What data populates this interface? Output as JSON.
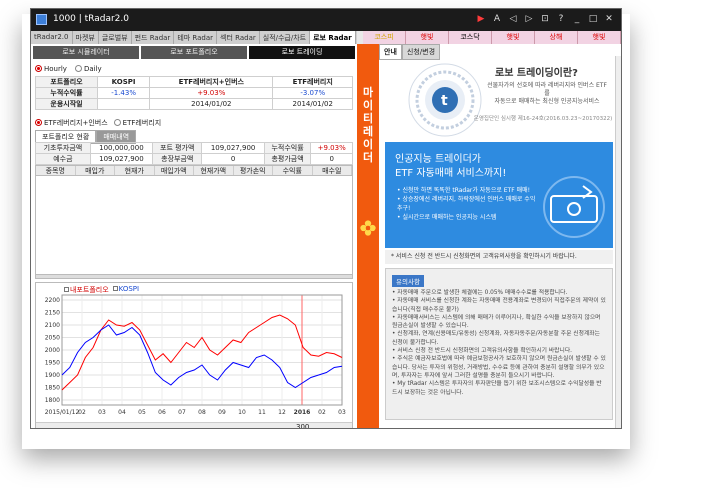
{
  "window": {
    "title": "1000 | tRadar2.0"
  },
  "top_tabs": [
    "tRadar2.0",
    "마켓뷰",
    "글로벌뷰",
    "펀드 Radar",
    "테마 Radar",
    "섹터 Radar",
    "실적/수급/차트",
    "로보 Radar"
  ],
  "index_bar": [
    {
      "label": "코스피",
      "color": "#d1a400"
    },
    {
      "label": "햇빛",
      "color": "#d00000"
    },
    {
      "label": "코스닥",
      "color": "#000000"
    },
    {
      "label": "햇빛",
      "color": "#d00000"
    },
    {
      "label": "상해",
      "color": "#d00000"
    },
    {
      "label": "햇빛",
      "color": "#d00000"
    }
  ],
  "sub_buttons": [
    "로보 시뮬레이터",
    "로보 포트폴리오",
    "로보 트레이딩"
  ],
  "period": {
    "hourly": "Hourly",
    "daily": "Daily",
    "selected": "Hourly"
  },
  "summary_table": {
    "headers": [
      "포트폴리오",
      "KOSPI",
      "ETF레버리지+인버스",
      "ETF레버리지"
    ],
    "rows": [
      {
        "label": "누적수익률",
        "values": [
          "-1.43%",
          "+9.03%",
          "-3.07%"
        ]
      },
      {
        "label": "운용시작일",
        "values": [
          "",
          "2014/01/02",
          "2014/01/02"
        ]
      }
    ]
  },
  "strategy": {
    "opt1": "ETF레버리지+인버스",
    "opt2": "ETF레버리지",
    "selected": "ETF레버리지+인버스"
  },
  "portfolio_tabs": [
    "포트폴리오 현황",
    "매매내역"
  ],
  "portfolio_table": {
    "rows": [
      [
        "기초투자금액",
        "100,000,000",
        "포트 평가액",
        "109,027,900",
        "누적수익률",
        "+9.03%"
      ],
      [
        "예수금",
        "109,027,900",
        "총장부금액",
        "0",
        "총평가금액",
        "0"
      ]
    ]
  },
  "holdings_columns": [
    "종목명",
    "매입가",
    "현재가",
    "매입가액",
    "현재가액",
    "평가손익",
    "수익률",
    "매수일"
  ],
  "chart_data": {
    "type": "line",
    "series": [
      {
        "name": "내포트폴리오",
        "color": "#ff0000",
        "values": [
          1840,
          1870,
          1900,
          1970,
          2010,
          2080,
          2120,
          2100,
          2095,
          2110,
          2080,
          2020,
          1960,
          1985,
          1950,
          1990,
          2030,
          2010,
          2050,
          2000,
          1980,
          2010,
          2040,
          2030,
          2070,
          2090,
          2110,
          2130,
          2140,
          2125,
          2100,
          2010,
          1980,
          1975,
          1990,
          1985,
          1970
        ]
      },
      {
        "name": "KOSPI",
        "color": "#0000ff",
        "values": [
          1900,
          1930,
          1990,
          2030,
          2050,
          2080,
          2100,
          2060,
          2070,
          2090,
          2060,
          1990,
          1910,
          1880,
          1860,
          1890,
          1910,
          1920,
          1940,
          1900,
          1880,
          1920,
          1950,
          1940,
          1930,
          1970,
          1980,
          1960,
          1930,
          1870,
          1850,
          1870,
          1890,
          1900,
          1910,
          1930,
          1935
        ]
      }
    ],
    "x_ticks": [
      "2015/01/12",
      "02",
      "03",
      "04",
      "05",
      "06",
      "07",
      "08",
      "09",
      "10",
      "11",
      "12",
      "2016",
      "02",
      "03"
    ],
    "y_ticks": [
      1800,
      1850,
      1900,
      1950,
      2000,
      2050,
      2100,
      2150,
      2200
    ],
    "ylim": [
      1780,
      2220
    ],
    "zoom_value": "300"
  },
  "vertical_brand": [
    "마",
    "이",
    "티",
    "레",
    "이",
    "더"
  ],
  "right_panel": {
    "tabs": [
      "안내",
      "신청/변경"
    ],
    "title": "로보 트레이딩이란?",
    "desc_line1": "선물자가의 선호에 따라 레버리지와 인버스 ETF를",
    "desc_line2": "자동으로 매매하는 최신형 인공지능서비스",
    "sub": "운영집단인 심시행 제16-24호(2016.03.23~20170322)",
    "banner_t1": "인공지능 트레이더가",
    "banner_t2": "ETF 자동매매 서비스까지!",
    "banner_items": [
      "신청만 하면 똑똑한 tRadar가 자동으로 ETF 매매!",
      "상승장에선 레버리지, 하락장에선 인버스 매매로 수익추구!",
      "실시간으로 매매하는 인공지능 시스템"
    ],
    "notice": "* 서비스 신청 전 반드시 신청화면의 고객유의사항을 확인하시기 바랍니다.",
    "caution_title": "유의사항",
    "caution_items": [
      "자동매매 주문으로 발생한 체결에는 0.05% 매매수수료를 적용합니다.",
      "자동매매 서비스를 신청한 계좌는 자동매매 전용계좌로 변경되어 직접주문의 제약이 있습니다(직접 매수주문 불가)",
      "자동매매서비스는 시스템에 의해 매매가 이루어지나, 확실한 수익을 보장하지 않으며 원금손실이 발생할 수 있습니다.",
      "신청계좌, 연계(신용매도/유동성) 신청계좌, 자동자동주문/자동분할 주문 신청계좌는 신청이 불가합니다.",
      "서비스 신청 전 반드시 신청화면의 고객유의사항을 확인하시기 바랍니다.",
      "주식은 예금자보호법에 따라 예금보험공사가 보호하지 않으며 원금손실이 발생할 수 있습니다. 당사는 투자의 위험성, 거래방법, 수수료 등에 관하여 충분히 설명할 의무가 있으며, 투자자는 투자에 앞서 그러한 설명을 충분히 들으시기 바랍니다.",
      "My tRadar 시스템은 투자자의 투자판단을 돕기 위한 보조시스템으로 수익달성을 반드시 보장하는 것은 아닙니다."
    ]
  }
}
